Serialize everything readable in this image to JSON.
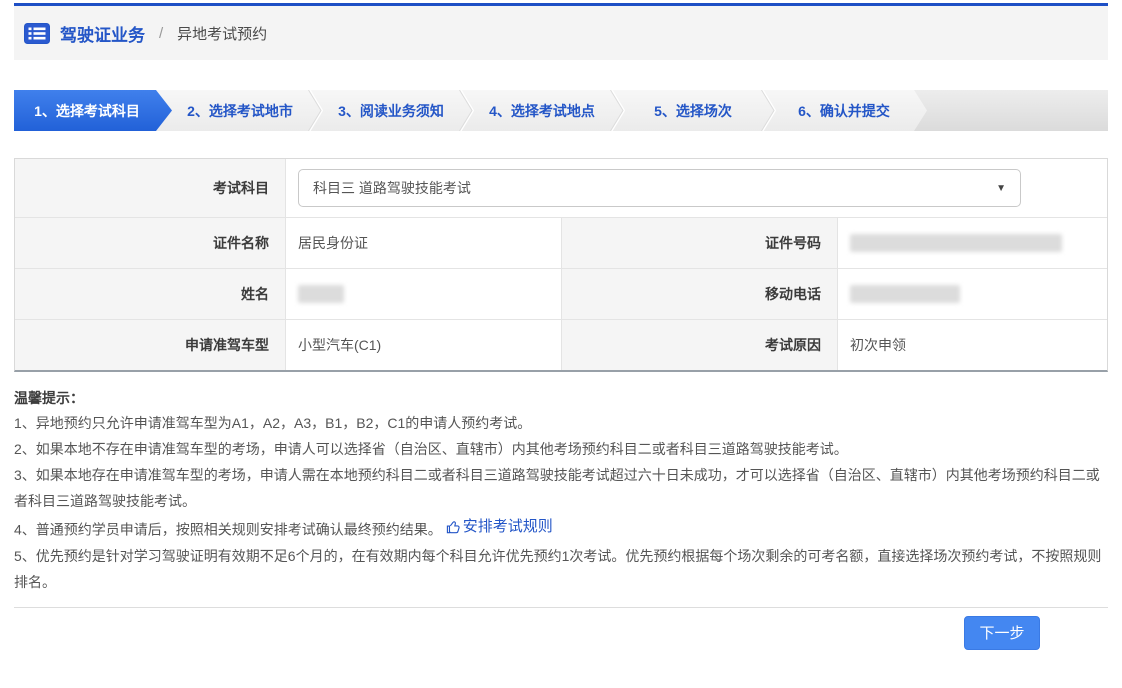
{
  "breadcrumb": {
    "section": "驾驶证业务",
    "separator": "/",
    "current": "异地考试预约"
  },
  "steps": [
    {
      "label": "1、选择考试科目",
      "active": true
    },
    {
      "label": "2、选择考试地市",
      "active": false
    },
    {
      "label": "3、阅读业务须知",
      "active": false
    },
    {
      "label": "4、选择考试地点",
      "active": false
    },
    {
      "label": "5、选择场次",
      "active": false
    },
    {
      "label": "6、确认并提交",
      "active": false
    }
  ],
  "form": {
    "exam_subject": {
      "label": "考试科目",
      "value": "科目三 道路驾驶技能考试"
    },
    "id_type": {
      "label": "证件名称",
      "value": "居民身份证"
    },
    "id_number": {
      "label": "证件号码",
      "value": "",
      "redacted": true
    },
    "name": {
      "label": "姓名",
      "value": "",
      "redacted": true
    },
    "mobile": {
      "label": "移动电话",
      "value": "",
      "redacted": true
    },
    "vehicle_type": {
      "label": "申请准驾车型",
      "value": "小型汽车(C1)"
    },
    "exam_reason": {
      "label": "考试原因",
      "value": "初次申领"
    }
  },
  "tips": {
    "title": "温馨提示：",
    "item1": "1、异地预约只允许申请准驾车型为A1，A2，A3，B1，B2，C1的申请人预约考试。",
    "item2": "2、如果本地不存在申请准驾车型的考场，申请人可以选择省（自治区、直辖市）内其他考场预约科目二或者科目三道路驾驶技能考试。",
    "item3": "3、如果本地存在申请准驾车型的考场，申请人需在本地预约科目二或者科目三道路驾驶技能考试超过六十日未成功，才可以选择省（自治区、直辖市）内其他考场预约科目二或者科目三道路驾驶技能考试。",
    "item4_text": "4、普通预约学员申请后，按照相关规则安排考试确认最终预约结果。",
    "item4_link": "安排考试规则",
    "item5": "5、优先预约是针对学习驾驶证明有效期不足6个月的，在有效期内每个科目允许优先预约1次考试。优先预约根据每个场次剩余的可考名额，直接选择场次预约考试，不按照规则排名。"
  },
  "footer": {
    "next_label": "下一步"
  },
  "icons": {
    "dropdown_arrow": "▼"
  },
  "colors": {
    "brand_blue": "#2456c7",
    "top_line": "#1d4fc5",
    "active_step_bg": "#2f6ce2",
    "button_bg": "#4487f1",
    "header_bg": "#f4f4f4",
    "label_cell_bg": "#f5f5f5"
  }
}
